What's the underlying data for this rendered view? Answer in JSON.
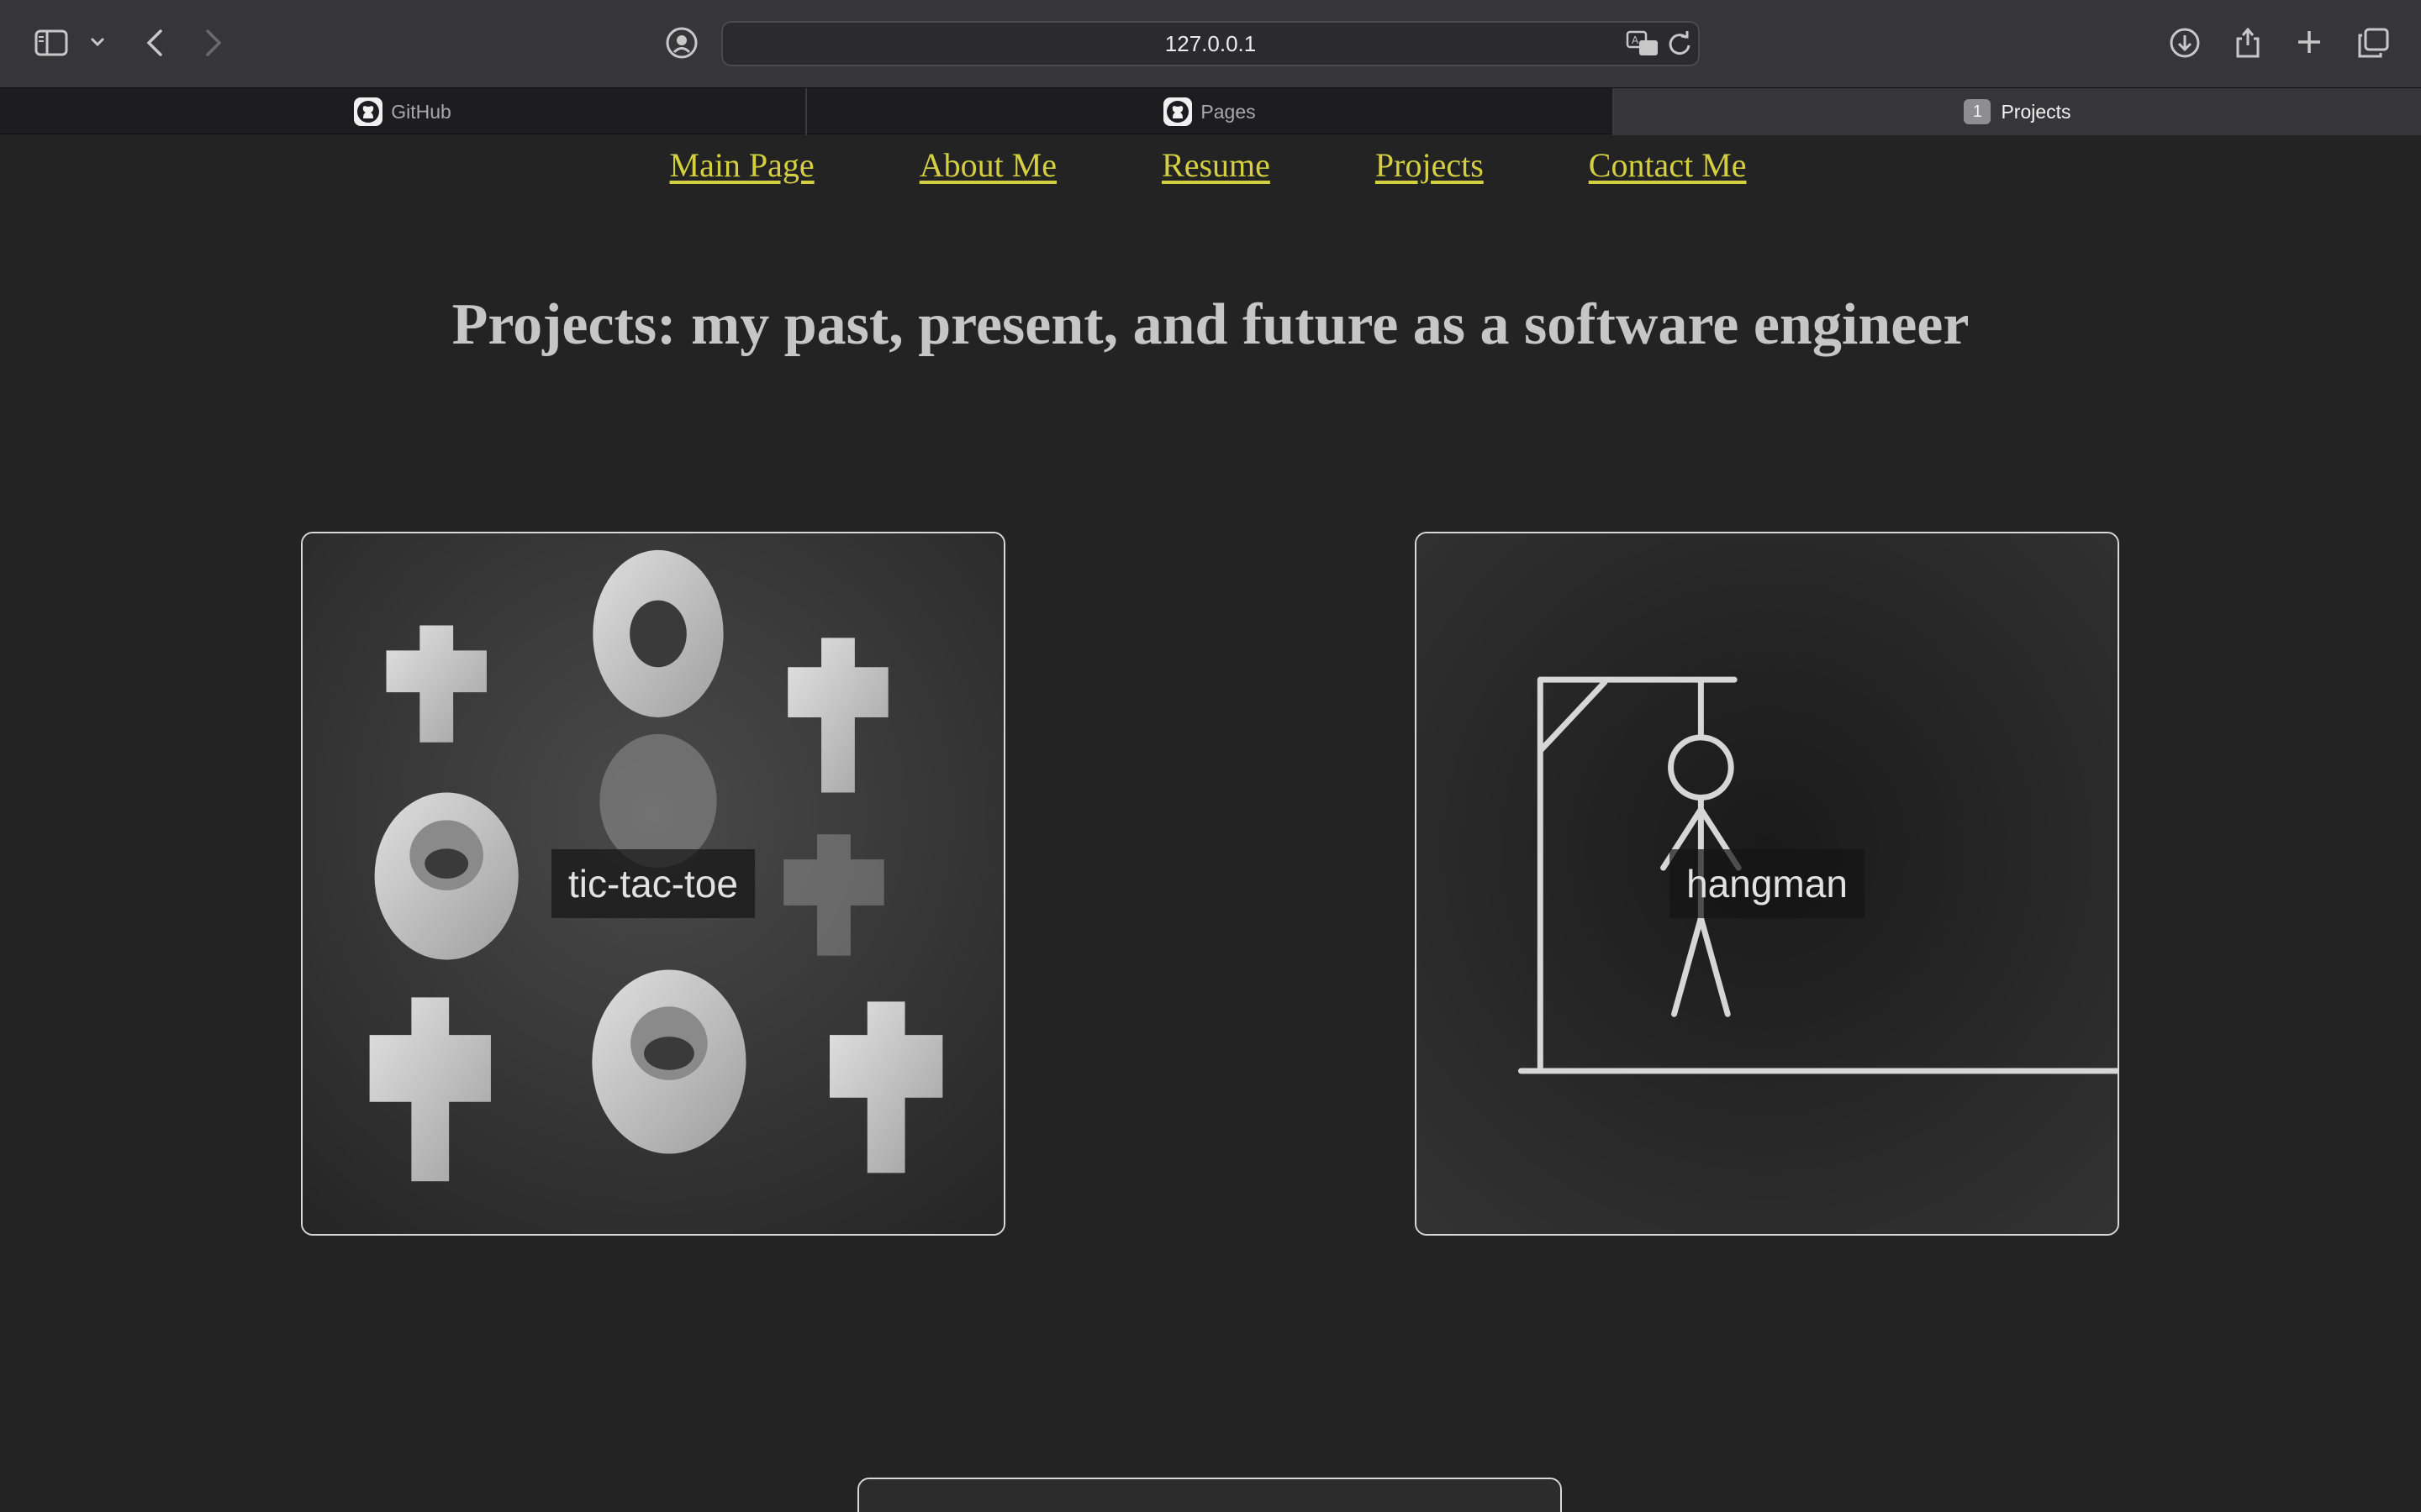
{
  "browser": {
    "url": "127.0.0.1",
    "tabs": [
      {
        "label": "GitHub",
        "icon": "github-icon",
        "active": false
      },
      {
        "label": "Pages",
        "icon": "github-icon",
        "active": false
      },
      {
        "label": "Projects",
        "badge": "1",
        "active": true
      }
    ]
  },
  "nav": {
    "items": [
      "Main Page",
      "About Me",
      "Resume",
      "Projects",
      "Contact Me"
    ],
    "link_color": "#d3cf40"
  },
  "page": {
    "heading": "Projects: my past, present, and future as a software engineer",
    "background": "#232323"
  },
  "projects": [
    {
      "label": "tic-tac-toe",
      "image": "tic-tac-toe pieces photo"
    },
    {
      "label": "hangman",
      "image": "chalkboard hangman drawing"
    }
  ]
}
